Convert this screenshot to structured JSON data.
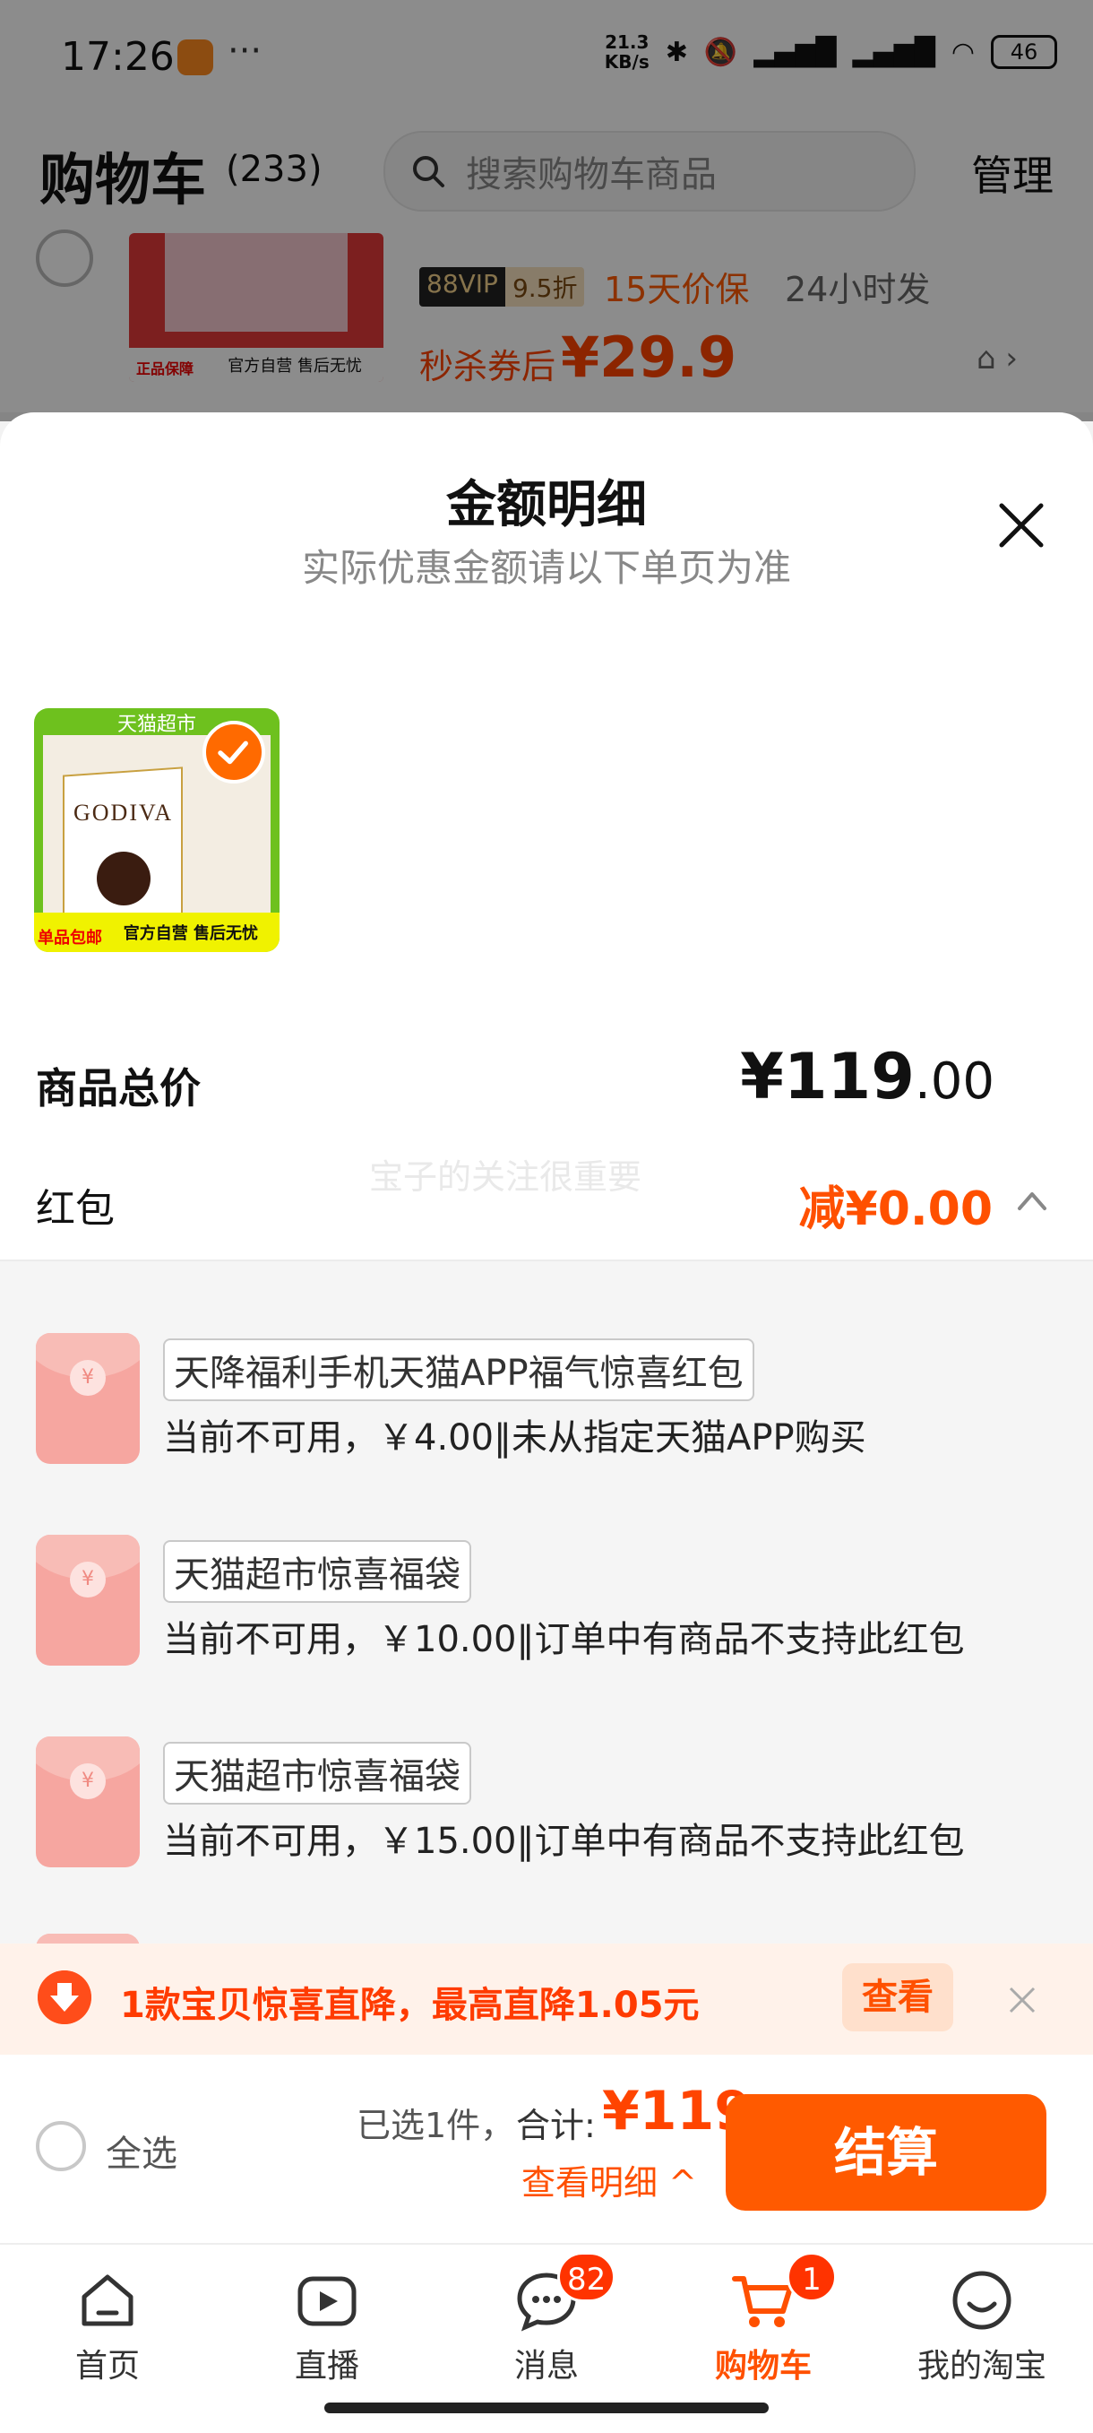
{
  "status_bar": {
    "time": "17:26",
    "dots": "···",
    "net_speed_value": "21.3",
    "net_speed_unit": "KB/s",
    "battery": "46"
  },
  "cart": {
    "title": "购物车",
    "count": "(233)",
    "search_placeholder": "搜索购物车商品",
    "manage_label": "管理"
  },
  "bg_item": {
    "img_tag": "正品保障",
    "img_strip": "官方自营 售后无忧",
    "vip_label": "88VIP",
    "vip_discount": "9.5折",
    "price_guard": "15天价保",
    "ship": "24小时发",
    "price_label": "秒杀券后",
    "price": "¥29.9"
  },
  "sheet": {
    "title": "金额明细",
    "subtitle": "实际优惠金额请以下单页为准",
    "thumb_banner": "天猫超市",
    "thumb_brand": "GODIVA",
    "thumb_strip": "官方自营 售后无忧",
    "thumb_tag": "单品包邮",
    "total_label": "商品总价",
    "total_int": "¥119",
    "total_dec": ".00",
    "redpack_label": "红包",
    "redpack_value": "减¥0.00",
    "watermark": "宝子的关注很重要"
  },
  "coupons": [
    {
      "name": "天降福利手机天猫APP福气惊喜红包",
      "desc": "当前不可用，￥4.00‖未从指定天猫APP购买"
    },
    {
      "name": "天猫超市惊喜福袋",
      "desc": "当前不可用，￥10.00‖订单中有商品不支持此红包"
    },
    {
      "name": "天猫超市惊喜福袋",
      "desc": "当前不可用，￥15.00‖订单中有商品不支持此红包"
    }
  ],
  "drop_banner": {
    "text": "1款宝贝惊喜直降，最高直降1.05元",
    "view_label": "查看"
  },
  "checkout": {
    "select_all": "全选",
    "selected_count": "已选1件，",
    "sum_label": "合计:",
    "sum_value": "¥119",
    "view_detail": "查看明细 ^",
    "button_label": "结算"
  },
  "tabs": [
    {
      "label": "首页",
      "icon": "home-icon"
    },
    {
      "label": "直播",
      "icon": "live-play-icon"
    },
    {
      "label": "消息",
      "icon": "message-icon",
      "badge": "82"
    },
    {
      "label": "购物车",
      "icon": "cart-icon",
      "badge": "1",
      "active": true
    },
    {
      "label": "我的淘宝",
      "icon": "profile-smile-icon"
    }
  ],
  "colors": {
    "accent": "#ff5000",
    "checkout_button": "#ff5a00",
    "badge": "#ff3300"
  }
}
